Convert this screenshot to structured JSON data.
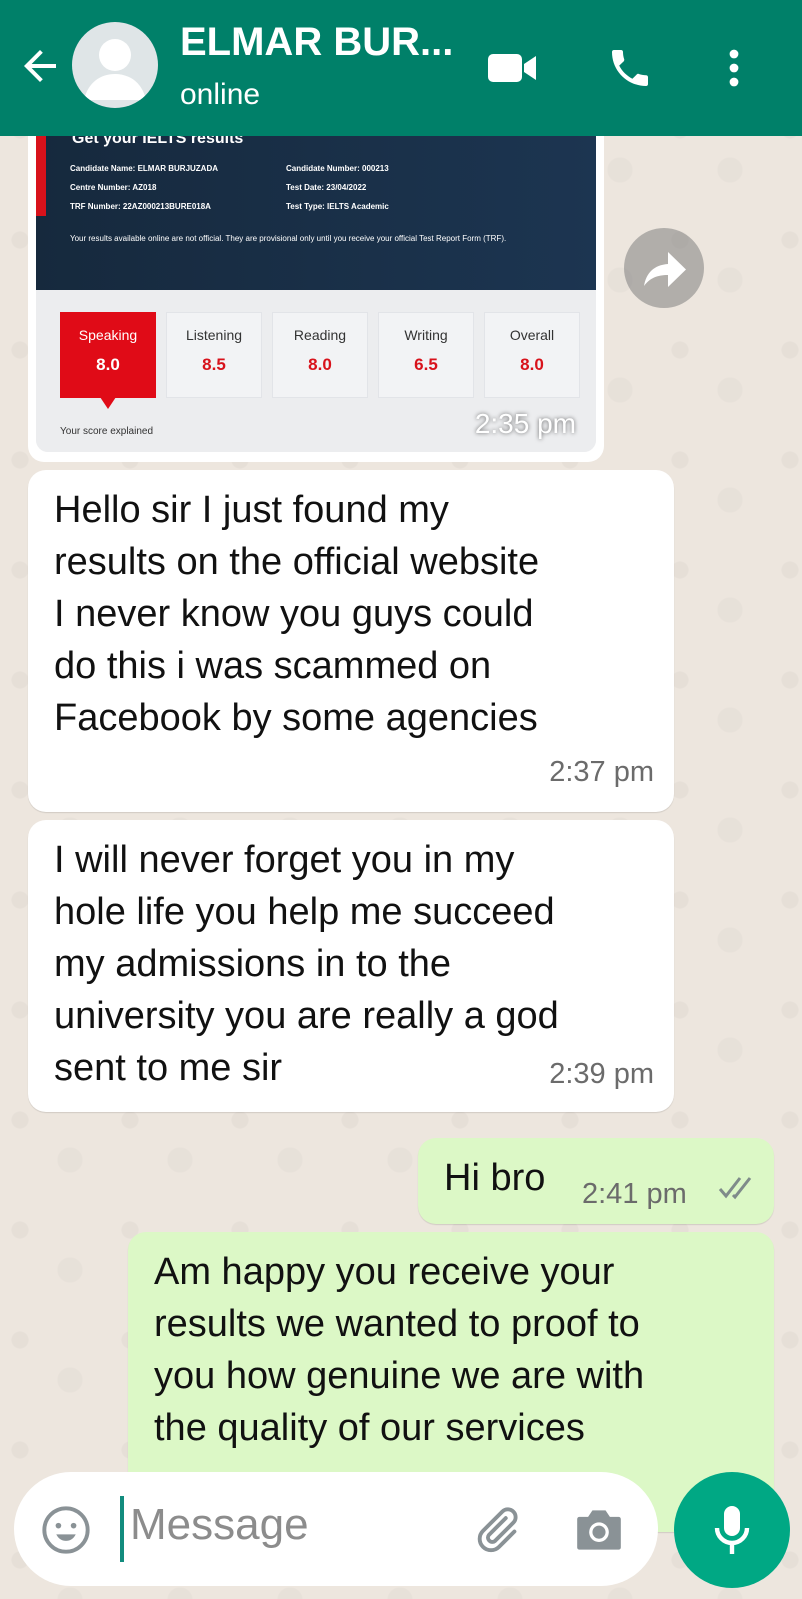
{
  "header": {
    "contact_name": "ELMAR BUR...",
    "status": "online"
  },
  "messages": [
    {
      "type": "image",
      "direction": "incoming",
      "time": "2:35 pm",
      "screenshot": {
        "heading": "Get your IELTS results",
        "candidate_name": "Candidate Name: ELMAR BURJUZADA",
        "candidate_number": "Candidate Number: 000213",
        "centre_number": "Centre Number: AZ018",
        "test_date": "Test Date: 23/04/2022",
        "trf_number": "TRF Number: 22AZ000213BURE018A",
        "test_type": "Test Type: IELTS Academic",
        "notice": "Your results available online are not official. They are provisional only until you receive your official Test Report Form (TRF).",
        "scores": [
          {
            "label": "Speaking",
            "value": "8.0",
            "selected": true
          },
          {
            "label": "Listening",
            "value": "8.5",
            "selected": false
          },
          {
            "label": "Reading",
            "value": "8.0",
            "selected": false
          },
          {
            "label": "Writing",
            "value": "6.5",
            "selected": false
          },
          {
            "label": "Overall",
            "value": "8.0",
            "selected": false
          }
        ],
        "explained": "Your score explained"
      }
    },
    {
      "type": "text",
      "direction": "incoming",
      "lines": [
        "Hello sir I just found my",
        "results on the official website",
        "I never know you guys could",
        "do this i was scammed on",
        "Facebook by some agencies"
      ],
      "time": "2:37 pm"
    },
    {
      "type": "text",
      "direction": "incoming",
      "lines": [
        "I will never forget you in my",
        "hole life you help me succeed",
        "my admissions in to the",
        "university you are really a god",
        "sent to me sir"
      ],
      "time": "2:39 pm"
    },
    {
      "type": "text",
      "direction": "outgoing",
      "lines": [
        "Hi bro"
      ],
      "time": "2:41 pm",
      "read": true
    },
    {
      "type": "text",
      "direction": "outgoing",
      "lines": [
        "Am happy you receive your",
        "results we wanted to proof to",
        "you how genuine we are with",
        "the quality of our services"
      ]
    }
  ],
  "composer": {
    "placeholder": "Message"
  },
  "colors": {
    "header": "#008069",
    "incoming_bubble": "#ffffff",
    "outgoing_bubble": "#dcf8c6",
    "mic_button": "#00a884",
    "wallpaper": "#ede6de"
  },
  "icons": [
    "back-arrow-icon",
    "avatar-placeholder-icon",
    "video-call-icon",
    "phone-icon",
    "more-vert-icon",
    "forward-icon",
    "emoji-icon",
    "attach-icon",
    "camera-icon",
    "mic-icon",
    "double-check-icon"
  ]
}
